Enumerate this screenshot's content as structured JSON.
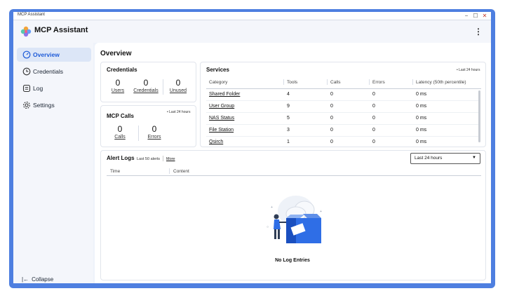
{
  "window": {
    "title": "MCP Assistant",
    "controls": [
      "−",
      "☐",
      "✕"
    ]
  },
  "app": {
    "title": "MCP Assistant",
    "menu_icon": "kebab-menu-icon"
  },
  "sidebar": {
    "items": [
      {
        "label": "Overview",
        "icon": "gauge-icon",
        "active": true
      },
      {
        "label": "Credentials",
        "icon": "clock-icon",
        "active": false
      },
      {
        "label": "Log",
        "icon": "log-icon",
        "active": false
      },
      {
        "label": "Settings",
        "icon": "gear-icon",
        "active": false
      }
    ],
    "collapse_label": "Collapse"
  },
  "main": {
    "title": "Overview"
  },
  "credentials": {
    "title": "Credentials",
    "stats": [
      {
        "value": "0",
        "label": "Users"
      },
      {
        "value": "0",
        "label": "Credentials"
      },
      {
        "value": "0",
        "label": "Unused"
      }
    ]
  },
  "mcp_calls": {
    "title": "MCP Calls",
    "range": "• Last 24 hours",
    "stats": [
      {
        "value": "0",
        "label": "Calls"
      },
      {
        "value": "0",
        "label": "Errors"
      }
    ]
  },
  "services": {
    "title": "Services",
    "range": "• Last 24 hours",
    "columns": [
      "Category",
      "Tools",
      "Calls",
      "Errors",
      "Latency (50th percentile)"
    ],
    "rows": [
      [
        "Shared Folder",
        "4",
        "0",
        "0",
        "0 ms"
      ],
      [
        "User Group",
        "9",
        "0",
        "0",
        "0 ms"
      ],
      [
        "NAS Status",
        "5",
        "0",
        "0",
        "0 ms"
      ],
      [
        "File Station",
        "3",
        "0",
        "0",
        "0 ms"
      ],
      [
        "Qsirch",
        "1",
        "0",
        "0",
        "0 ms"
      ]
    ]
  },
  "alert_logs": {
    "title": "Alert Logs",
    "subtitle": "Last 50 alerts",
    "more": "More",
    "range_select": "Last 24 hours",
    "columns": [
      "Time",
      "Content"
    ],
    "empty_text": "No Log Entries"
  }
}
